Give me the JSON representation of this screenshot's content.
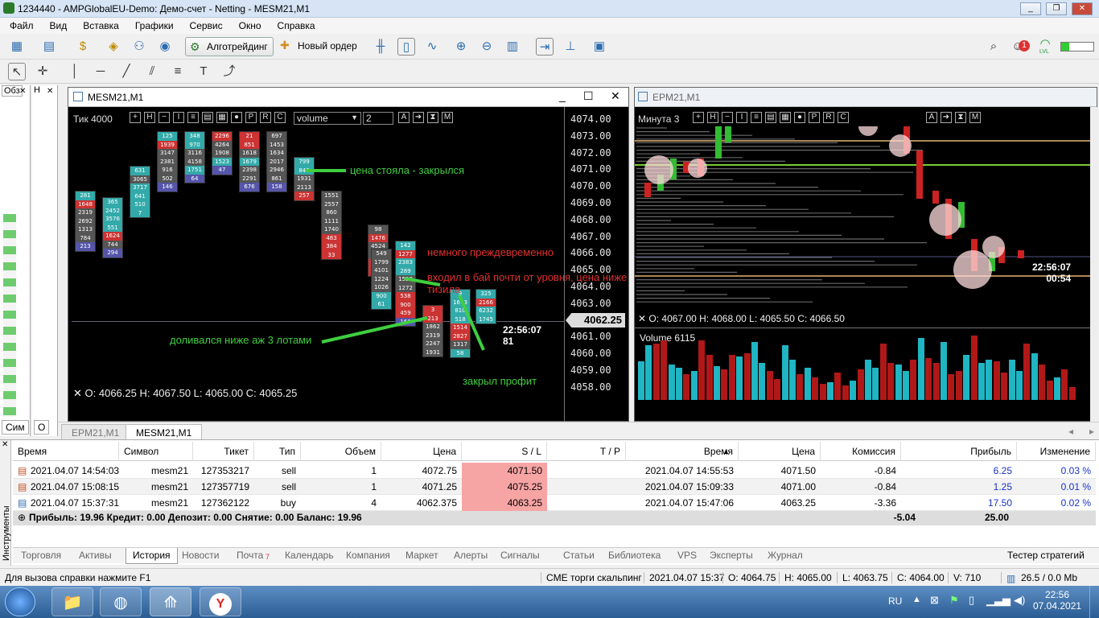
{
  "window": {
    "title": "1234440 - AMPGlobalEU-Demo: Демо-счет - Netting - MESM21,M1"
  },
  "menu": [
    "Файл",
    "Вид",
    "Вставка",
    "Графики",
    "Сервис",
    "Окно",
    "Справка"
  ],
  "toolbar": {
    "algo": "Алготрейдинг",
    "new_order": "Новый ордер",
    "badge": "1",
    "lvl": "LVL"
  },
  "left_panel": {
    "tab1": "Обз",
    "tab2": "Н",
    "tab3": "Сим",
    "tab4": "О"
  },
  "chart1": {
    "title": "MESM21,M1",
    "tick_label": "Тик",
    "tick_value": "4000",
    "indicator": "volume",
    "indicator_num": "2",
    "prices": [
      "4074.00",
      "4073.00",
      "4072.00",
      "4071.00",
      "4070.00",
      "4069.00",
      "4068.00",
      "4067.00",
      "4066.00",
      "4065.00",
      "4064.00",
      "4063.00",
      "4062.00",
      "4061.00",
      "4060.00",
      "4059.00",
      "4058.00"
    ],
    "current_price": "4062.25",
    "time": "22:56:07",
    "time_sub": "81",
    "ohlc": "O: 4066.25  H: 4067.50  L: 4065.00  C: 4065.25",
    "annotations": {
      "a1": "цена стояла - закрылся",
      "a2": "немного преждевременно",
      "a3": "входил в бай почти от уровня, цена ниже тизила",
      "a4": "доливался ниже аж 3 лотами",
      "a5": "закрыл профит"
    },
    "cells": {
      "c0": [
        "281",
        "1648",
        "2319",
        "2692",
        "1313",
        "784",
        "213"
      ],
      "c1": [
        "365",
        "2452",
        "3576",
        "551",
        "1624",
        "744",
        "294"
      ],
      "c2": [
        "631",
        "3065",
        "3717",
        "641",
        "510",
        "7"
      ],
      "c3": [
        "125",
        "1939",
        "3147",
        "2381",
        "916",
        "502",
        "146"
      ],
      "c4": [
        "348",
        "970",
        "3116",
        "4158",
        "1751",
        "64"
      ],
      "c5": [
        "2296",
        "4264",
        "1908",
        "1523",
        "47"
      ],
      "c6": [
        "21",
        "851",
        "1618",
        "1679",
        "2398",
        "2291",
        "676"
      ],
      "c7": [
        "697",
        "1453",
        "1634",
        "2017",
        "2946",
        "861",
        "158"
      ],
      "c8": [
        "799",
        "846",
        "1931",
        "2113",
        "257"
      ],
      "c9": [
        "1551",
        "2557",
        "860",
        "1111",
        "1740",
        "483",
        "384",
        "33"
      ],
      "c10": [
        "98",
        "1476",
        "4524",
        "2370",
        "552",
        "692"
      ],
      "c11": [
        "549",
        "1799",
        "4101",
        "1224",
        "1026",
        "900",
        "61"
      ],
      "c12": [
        "142",
        "1277",
        "2383",
        "289",
        "1539",
        "1272",
        "538",
        "900",
        "459",
        "166"
      ],
      "c13": [
        "3",
        "213",
        "1862",
        "2319",
        "2247",
        "1931"
      ],
      "c14": [
        "9",
        "1673",
        "810",
        "518",
        "1514",
        "2827",
        "1317",
        "58"
      ],
      "c15": [
        "325",
        "2166",
        "6232",
        "1745"
      ]
    }
  },
  "chart2": {
    "title": "EPM21,M1",
    "tf_label": "Минута",
    "tf_value": "3",
    "time": "22:56:07",
    "countdown": "00:54",
    "ohlc": "O: 4067.00  H: 4068.00  L: 4065.50  C: 4066.50",
    "volume_title": "Volume 6115",
    "volumes": [
      60,
      85,
      88,
      92,
      55,
      50,
      40,
      45,
      92,
      70,
      52,
      48,
      70,
      68,
      72,
      90,
      58,
      45,
      32,
      85,
      62,
      40,
      50,
      35,
      25,
      28,
      42,
      22,
      30,
      48,
      62,
      50,
      88,
      58,
      55,
      45,
      62,
      96,
      65,
      58,
      90,
      40,
      45,
      70,
      100,
      58,
      62,
      60,
      42,
      62,
      45,
      88,
      72,
      55,
      30,
      35,
      48,
      20
    ],
    "vol_colors": "mixed"
  },
  "chart_tabs": [
    "EPM21,M1",
    "MESM21,M1"
  ],
  "table": {
    "headers": [
      "Время",
      "Символ",
      "Тикет",
      "Тип",
      "Объем",
      "Цена",
      "S / L",
      "T / P",
      "Время",
      "Цена",
      "Комиссия",
      "Прибыль",
      "Изменение"
    ],
    "rows": [
      [
        "2021.04.07 14:54:03",
        "mesm21",
        "127353217",
        "sell",
        "1",
        "4072.75",
        "4071.50",
        "",
        "2021.04.07 14:55:53",
        "4071.50",
        "-0.84",
        "6.25",
        "0.03 %"
      ],
      [
        "2021.04.07 15:08:15",
        "mesm21",
        "127357719",
        "sell",
        "1",
        "4071.25",
        "4075.25",
        "",
        "2021.04.07 15:09:33",
        "4071.00",
        "-0.84",
        "1.25",
        "0.01 %"
      ],
      [
        "2021.04.07 15:37:31",
        "mesm21",
        "127362122",
        "buy",
        "4",
        "4062.375",
        "4063.25",
        "",
        "2021.04.07 15:47:06",
        "4063.25",
        "-3.36",
        "17.50",
        "0.02 %"
      ]
    ],
    "summary": "Прибыль: 19.96  Кредит: 0.00  Депозит: 0.00  Снятие: 0.00  Баланс: 19.96",
    "sum_commission": "-5.04",
    "sum_profit": "25.00"
  },
  "toolbox_side": "Инструменты",
  "bottom_tabs": [
    "Торговля",
    "Активы",
    "История",
    "Новости",
    "Почта",
    "Календарь",
    "Компания",
    "Маркет",
    "Алерты",
    "Сигналы",
    "Статьи",
    "Библиотека",
    "VPS",
    "Эксперты",
    "Журнал"
  ],
  "mail_count": "7",
  "tester": "Тестер стратегий",
  "status": {
    "help": "Для вызова справки нажмите F1",
    "profile": "CME торги скальпинг",
    "datetime": "2021.04.07 15:37",
    "o": "O: 4064.75",
    "h": "H: 4065.00",
    "l": "L: 4063.75",
    "c": "C: 4064.00",
    "v": "V: 710",
    "net": "26.5 / 0.0 Mb"
  },
  "taskbar": {
    "lang": "RU",
    "time": "22:56",
    "date": "07.04.2021"
  },
  "colors": {
    "accent": "#2b6cb0",
    "sl_bg": "#f7a4a4",
    "profit_blue": "#1a33c4",
    "green_ann": "#3fcf3f",
    "red_ann": "#e03030"
  }
}
